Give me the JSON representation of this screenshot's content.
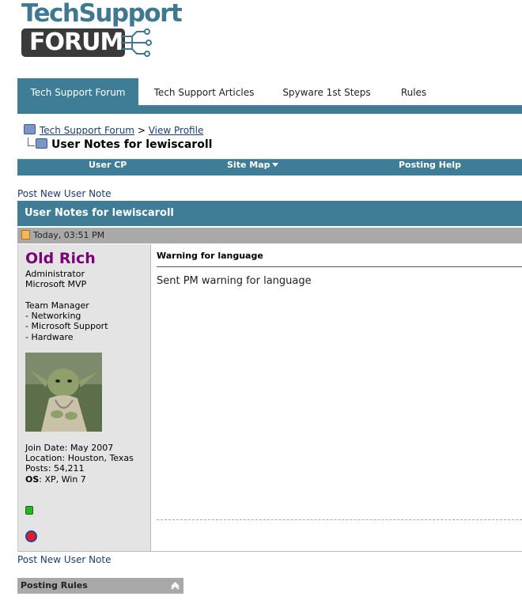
{
  "logo": {
    "line1": "TechSupport",
    "line2": "FORUM"
  },
  "tabs": [
    {
      "label": "Tech Support Forum",
      "active": true
    },
    {
      "label": "Tech Support Articles"
    },
    {
      "label": "Spyware 1st Steps"
    },
    {
      "label": "Rules"
    }
  ],
  "breadcrumb": {
    "forum_link": "Tech Support Forum",
    "separator": ">",
    "profile_link": "View Profile",
    "current": "User Notes for lewiscaroll"
  },
  "navbar": {
    "items": [
      "User CP",
      "Site Map",
      "Posting Help"
    ]
  },
  "post_link_top": "Post New User Note",
  "notes_header": "User Notes for lewiscaroll",
  "post": {
    "date": "Today, 03:51 PM",
    "user": {
      "name": "Old Rich",
      "title1": "Administrator",
      "title2": "Microsoft MVP",
      "role": "Team Manager",
      "teams": [
        "- Networking",
        "- Microsoft Support",
        "- Hardware"
      ],
      "join_date": "Join Date: May 2007",
      "location": "Location: Houston, Texas",
      "posts": "Posts: 54,211",
      "os_label": "OS",
      "os_value": ": XP, Win 7"
    },
    "note_title": "Warning for language",
    "note_text": "Sent PM warning for language"
  },
  "post_link_bottom": "Post New User Note",
  "posting_rules": "Posting Rules",
  "colors": {
    "accent": "#3f7c96",
    "username": "#7a007a",
    "link": "#1a3d6e"
  }
}
